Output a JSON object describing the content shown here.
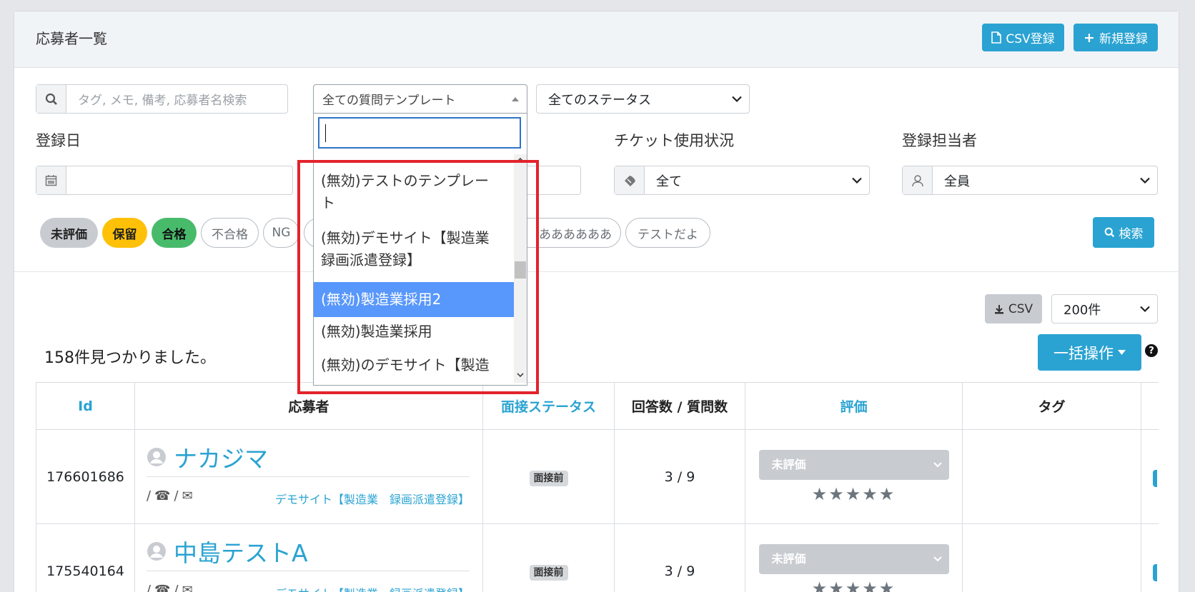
{
  "header": {
    "title": "応募者一覧",
    "csv_register": "CSV登録",
    "new_register": "新規登録"
  },
  "filters": {
    "search_placeholder": "タグ, メモ, 備考, 応募者名検索",
    "template_select": "全ての質問テンプレート",
    "status_select": "全てのステータス",
    "date_label": "登録日",
    "ticket_label": "チケット使用状況",
    "ticket_value": "全て",
    "owner_label": "登録担当者",
    "owner_value": "全員",
    "search_button": "検索"
  },
  "pills": [
    {
      "label": "未評価"
    },
    {
      "label": "保留"
    },
    {
      "label": "合格"
    },
    {
      "label": "不合格"
    },
    {
      "label": "NG"
    },
    {
      "label": "ああああああ"
    },
    {
      "label": "テストだよ"
    }
  ],
  "colors": {
    "info": "#2aa3d2",
    "warning": "#ffc107",
    "success": "#48bb6b",
    "gray": "#c8ccd1",
    "highlight": "#e3232b"
  },
  "dropdown": {
    "items": [
      "(無効)テストのテンプレー",
      "ト",
      "(無効)デモサイト【製造業",
      "録画派遣登録】",
      "(無効)製造業採用2",
      "(無効)製造業採用",
      "(無効)のデモサイト【製造"
    ]
  },
  "list": {
    "csv_button": "CSV",
    "per_page": "200件",
    "bulk_button": "一括操作",
    "help_icon": "?",
    "count_text": "158件見つかりました。"
  },
  "table": {
    "headers": [
      "Id",
      "応募者",
      "面接ステータス",
      "回答数 / 質問数",
      "評価",
      "タグ"
    ],
    "rows": [
      {
        "id": "176601686",
        "name": "ナカジマ",
        "contacts": "/",
        "contacts2": "/",
        "template": "デモサイト【製造業　録画派遣登録】",
        "status": "面接前",
        "answers": "3 / 9",
        "eval": "未評価",
        "stars": "★★★★★"
      },
      {
        "id": "175540164",
        "name": "中島テストA",
        "contacts": "/",
        "contacts2": "/",
        "template": "デモサイト【製造業　録画派遣登録】",
        "status": "面接前",
        "answers": "3 / 9",
        "eval": "未評価",
        "stars": "★★★★★"
      }
    ]
  }
}
